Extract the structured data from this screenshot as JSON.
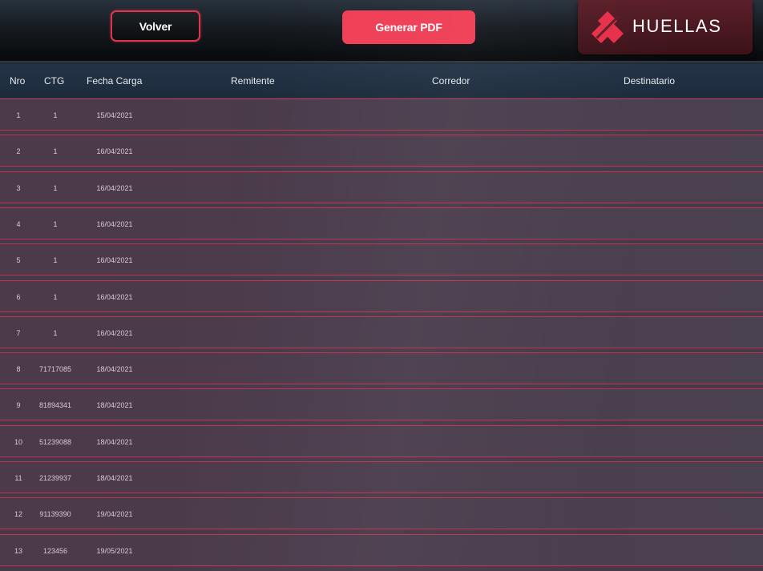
{
  "toolbar": {
    "back_label": "Volver",
    "pdf_label": "Generar PDF"
  },
  "brand": {
    "name": "HUELLAS",
    "logo_icon": "huellas-logo-mark",
    "accent": "#ef3e55"
  },
  "table": {
    "columns": [
      "Nro",
      "CTG",
      "Fecha Carga",
      "Remitente",
      "Corredor",
      "Destinatario"
    ],
    "rows": [
      {
        "nro": "1",
        "ctg": "1",
        "fecha": "15/04/2021",
        "remitente": "",
        "corredor": "",
        "destinatario": ""
      },
      {
        "nro": "2",
        "ctg": "1",
        "fecha": "16/04/2021",
        "remitente": "",
        "corredor": "",
        "destinatario": ""
      },
      {
        "nro": "3",
        "ctg": "1",
        "fecha": "16/04/2021",
        "remitente": "",
        "corredor": "",
        "destinatario": ""
      },
      {
        "nro": "4",
        "ctg": "1",
        "fecha": "16/04/2021",
        "remitente": "",
        "corredor": "",
        "destinatario": ""
      },
      {
        "nro": "5",
        "ctg": "1",
        "fecha": "16/04/2021",
        "remitente": "",
        "corredor": "",
        "destinatario": ""
      },
      {
        "nro": "6",
        "ctg": "1",
        "fecha": "16/04/2021",
        "remitente": "",
        "corredor": "",
        "destinatario": ""
      },
      {
        "nro": "7",
        "ctg": "1",
        "fecha": "16/04/2021",
        "remitente": "",
        "corredor": "",
        "destinatario": ""
      },
      {
        "nro": "8",
        "ctg": "71717085",
        "fecha": "18/04/2021",
        "remitente": "",
        "corredor": "",
        "destinatario": ""
      },
      {
        "nro": "9",
        "ctg": "81894341",
        "fecha": "18/04/2021",
        "remitente": "",
        "corredor": "",
        "destinatario": ""
      },
      {
        "nro": "10",
        "ctg": "51239088",
        "fecha": "18/04/2021",
        "remitente": "",
        "corredor": "",
        "destinatario": ""
      },
      {
        "nro": "11",
        "ctg": "21239937",
        "fecha": "18/04/2021",
        "remitente": "",
        "corredor": "",
        "destinatario": ""
      },
      {
        "nro": "12",
        "ctg": "91139390",
        "fecha": "19/04/2021",
        "remitente": "",
        "corredor": "",
        "destinatario": ""
      },
      {
        "nro": "13",
        "ctg": "123456",
        "fecha": "19/05/2021",
        "remitente": "",
        "corredor": "",
        "destinatario": ""
      }
    ]
  }
}
